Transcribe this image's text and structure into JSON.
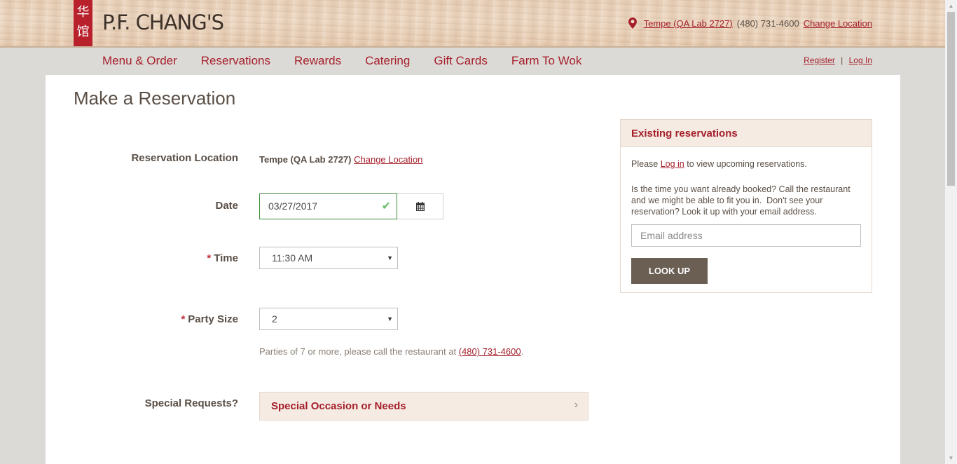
{
  "header": {
    "logo_chars": "华\n馆",
    "brand": "P.F. CHANG'S",
    "location_name": "Tempe (QA Lab 2727)",
    "phone": "(480) 731-4600",
    "change_location": "Change Location"
  },
  "nav": {
    "items": [
      "Menu & Order",
      "Reservations",
      "Rewards",
      "Catering",
      "Gift Cards",
      "Farm To Wok"
    ],
    "register": "Register",
    "separator": "|",
    "login": "Log In"
  },
  "page": {
    "title": "Make a Reservation"
  },
  "form": {
    "location_label": "Reservation Location",
    "location_value": "Tempe (QA Lab 2727)",
    "location_change": "Change Location",
    "date_label": "Date",
    "date_value": "03/27/2017",
    "time_required": "*",
    "time_label": "Time",
    "time_value": "11:30 AM",
    "party_required": "*",
    "party_label": "Party Size",
    "party_value": "2",
    "party_note_prefix": "Parties of 7 or more, please call the restaurant at ",
    "party_note_phone": "(480) 731-4600",
    "party_note_suffix": ".",
    "special_label": "Special Requests?",
    "special_button": "Special Occasion or Needs"
  },
  "existing": {
    "title": "Existing reservations",
    "please": "Please ",
    "login_link": "Log in",
    "view_text": " to view upcoming reservations.",
    "help_text": "Is the time you want already booked? Call the restaurant and we might be able to fit you in.  Don't see your reservation? Look it up with your email address.",
    "email_placeholder": "Email address",
    "lookup_button": "LOOK UP"
  },
  "colors": {
    "brand_red": "#a51f2b",
    "logo_red": "#b8202b",
    "button_brown": "#6b5e53"
  }
}
